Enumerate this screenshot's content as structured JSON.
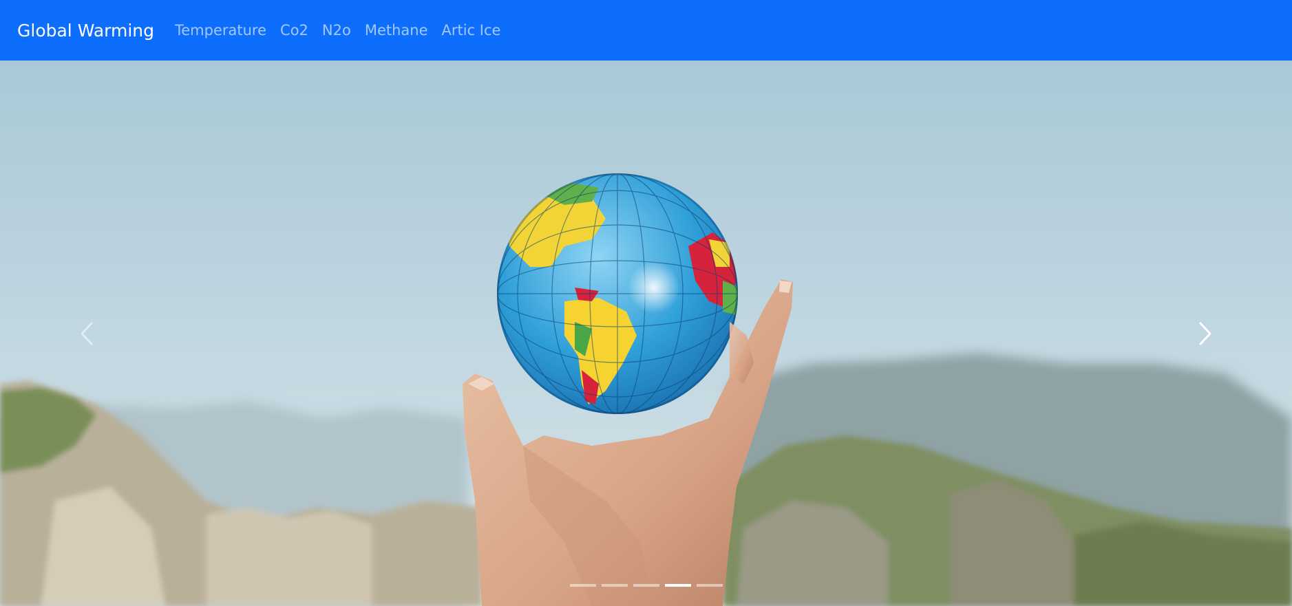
{
  "navbar": {
    "brand": "Global Warming",
    "background_color": "#0d6efd",
    "links": [
      {
        "label": "Temperature"
      },
      {
        "label": "Co2"
      },
      {
        "label": "N2o"
      },
      {
        "label": "Methane"
      },
      {
        "label": "Artic Ice"
      }
    ]
  },
  "carousel": {
    "slide_count": 5,
    "active_index": 3,
    "prev_icon": "chevron-left-icon",
    "next_icon": "chevron-right-icon",
    "image_description_icon": "globe-in-hand-photo"
  }
}
